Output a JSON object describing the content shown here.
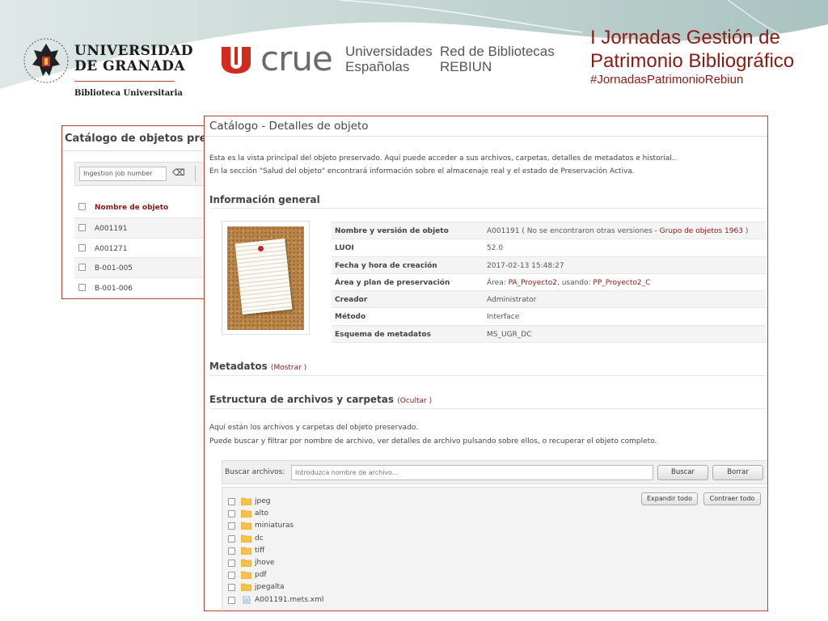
{
  "header": {
    "university": {
      "name_line1": "UNIVERSIDAD",
      "name_line2": "DE GRANADA",
      "subtitle": "Biblioteca Universitaria"
    },
    "crue": {
      "wordmark": "crue",
      "line1": "Universidades",
      "line2": "Españolas",
      "line3": "Red de Bibliotecas",
      "line4": "REBIUN"
    },
    "slide_title_line1": "I Jornadas Gestión de",
    "slide_title_line2": "Patrimonio Bibliográfico",
    "hashtag": "#JornadasPatrimonioRebiun"
  },
  "catalog_panel": {
    "title": "Catálogo de objetos preser",
    "search_placeholder": "Ingestion job number",
    "clear_icon": "backspace-icon",
    "column_header": "Nombre de objeto",
    "rows": [
      "A001191",
      "A001271",
      "B-001-005",
      "B-001-006"
    ]
  },
  "details": {
    "title": "Catálogo - Detalles de objeto",
    "description_line1": "Esta es la vista principal del objeto preservado. Aquí puede acceder a sus archivos, carpetas, detalles de metadatos e historial..",
    "description_line2": "En la sección \"Salud del objeto\" encontrará información sobre el almacenaje real y el estado de Preservación Activa.",
    "general_info_heading": "Información general",
    "general_info": {
      "object_name_label": "Nombre y versión de objeto",
      "object_name_value": "A001191",
      "object_name_note_open": "( No se encontraron otras versiones - ",
      "object_group_link": "Grupo de objetos 1963",
      "object_name_note_close": " )",
      "luoi_label": "LUOI",
      "luoi_value": "52.0",
      "created_label": "Fecha y hora de creación",
      "created_value": "2017-02-13 15:48:27",
      "area_label": "Área y plan de preservación",
      "area_prefix": "Área: ",
      "area_link": "PA_Proyecto2",
      "plan_prefix": ", usando: ",
      "plan_link": "PP_Proyecto2_C",
      "creator_label": "Creador",
      "creator_value": "Administrator",
      "method_label": "Método",
      "method_value": "Interface",
      "schema_label": "Esquema de metadatos",
      "schema_value": "MS_UGR_DC"
    },
    "metadata_heading": "Metadatos",
    "metadata_toggle": "Mostrar",
    "structure_heading": "Estructura de archivos y carpetas",
    "structure_toggle": "Ocultar",
    "files_desc_line1": "Aquí están los archivos y carpetas del objeto preservado.",
    "files_desc_line2": "Puede buscar y filtrar por nombre de archivo, ver detalles de archivo pulsando sobre ellos, o recuperar el objeto completo.",
    "file_search": {
      "label": "Buscar archivos:",
      "placeholder": "Introduzca nombre de archivo...",
      "search_button": "Buscar",
      "clear_button": "Borrar"
    },
    "tree": {
      "expand_button": "Expandir todo",
      "collapse_button": "Contraer todo",
      "items": [
        {
          "label": "jpeg",
          "type": "folder"
        },
        {
          "label": "alto",
          "type": "folder"
        },
        {
          "label": "miniaturas",
          "type": "folder"
        },
        {
          "label": "dc",
          "type": "folder"
        },
        {
          "label": "tiff",
          "type": "folder"
        },
        {
          "label": "jhove",
          "type": "folder"
        },
        {
          "label": "pdf",
          "type": "folder"
        },
        {
          "label": "jpegalta",
          "type": "folder"
        },
        {
          "label": "A001191.mets.xml",
          "type": "file"
        }
      ]
    }
  },
  "colors": {
    "accent": "#8b1a13",
    "panel_border": "#b2453a",
    "folder": "#f2c14e"
  }
}
